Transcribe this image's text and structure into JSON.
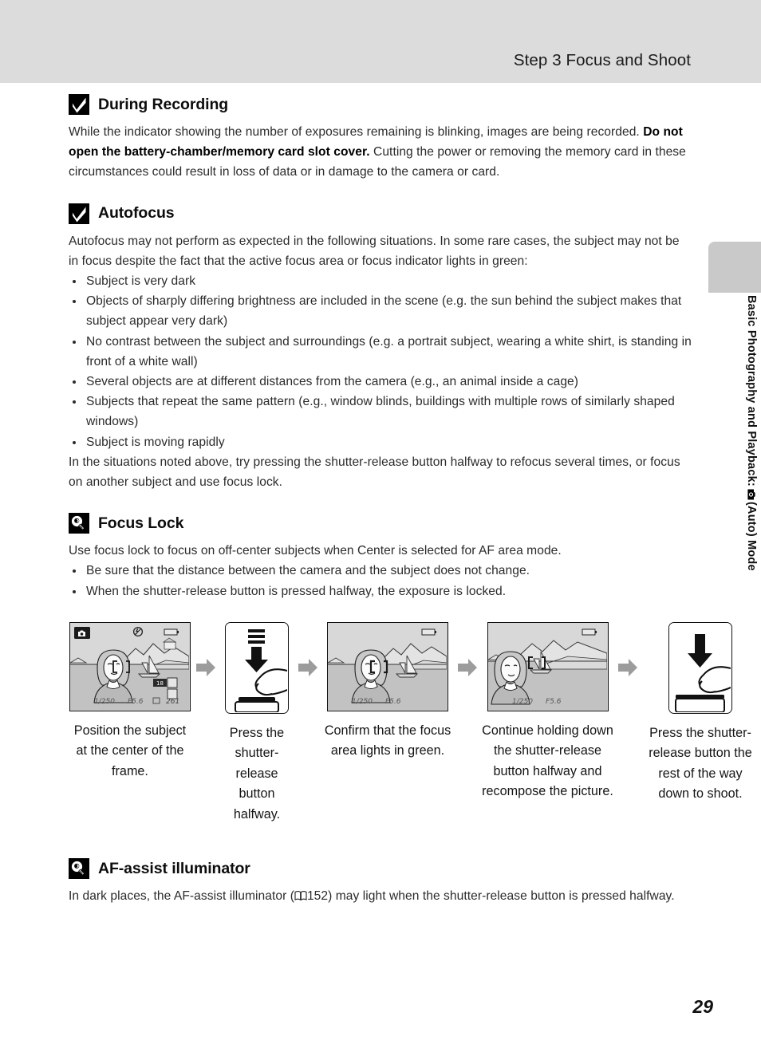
{
  "header": {
    "title": "Step 3 Focus and Shoot",
    "band_color": "#dcdcdc"
  },
  "sidebar": {
    "text_part1": "Basic Photography and Playback:",
    "camera_icon": "camera-auto-icon",
    "text_part2": "(Auto) Mode",
    "tab_color": "#c9c9c9"
  },
  "sections": [
    {
      "id": "during-recording",
      "icon": "checkmark-caution-icon",
      "title": "During Recording",
      "paragraph_pre": "While the indicator showing the number of exposures remaining is blinking, images are being recorded. ",
      "paragraph_bold": "Do not open the battery-chamber/memory card slot cover.",
      "paragraph_post": " Cutting the power or removing the memory card in these circumstances could result in loss of data or in damage to the camera or card."
    },
    {
      "id": "autofocus",
      "icon": "checkmark-caution-icon",
      "title": "Autofocus",
      "intro": "Autofocus may not perform as expected in the following situations. In some rare cases, the subject may not be in focus despite the fact that the active focus area or focus indicator lights in green:",
      "bullets": [
        "Subject is very dark",
        "Objects of sharply differing brightness are included in the scene (e.g. the sun behind the subject makes that subject appear very dark)",
        "No contrast between the subject and surroundings (e.g. a portrait subject, wearing a white shirt, is standing in front of a white wall)",
        "Several objects are at different distances from the camera (e.g., an animal inside a cage)",
        "Subjects that repeat the same pattern (e.g., window blinds, buildings with multiple rows of similarly shaped windows)",
        "Subject is moving rapidly"
      ],
      "outro": "In the situations noted above, try pressing the shutter-release button halfway to refocus several times, or focus on another subject and use focus lock."
    },
    {
      "id": "focus-lock",
      "icon": "lightbulb-tip-icon",
      "title": "Focus Lock",
      "intro": "Use focus lock to focus on off-center subjects when Center is selected for AF area mode.",
      "bullets": [
        "Be sure that the distance between the camera and the subject does not change.",
        "When the shutter-release button is pressed halfway, the exposure is locked."
      ]
    },
    {
      "id": "af-assist",
      "icon": "lightbulb-tip-icon",
      "title": "AF-assist illuminator",
      "text_pre": "In dark places, the AF-assist illuminator (",
      "book_icon": "open-book-reference-icon",
      "page_ref": "152",
      "text_post": ") may light when the shutter-release button is pressed halfway."
    }
  ],
  "flow": {
    "arrow_icon": "right-arrow-icon",
    "steps": [
      {
        "panel_type": "lcd",
        "panel_name": "camera-lcd-framing",
        "osd": {
          "mode_icon": "camera-auto-icon",
          "flash_off_icon": "flash-off-icon",
          "battery_icon": "battery-icon",
          "shutter_speed": "1/250",
          "aperture": "F5.6",
          "image_size": "18",
          "memory_icon": "memory-card-icon",
          "image_mode_icon": "image-quality-icon",
          "frames_icon": "frames-remaining-icon",
          "frames_remaining": "261"
        },
        "caption": "Position the subject at the center of the frame."
      },
      {
        "panel_type": "finger",
        "panel_name": "shutter-press-halfway",
        "press_depth": "halfway",
        "caption": "Press the shutter-release button halfway."
      },
      {
        "panel_type": "lcd",
        "panel_name": "camera-lcd-focus-confirmed",
        "osd": {
          "battery_icon": "battery-icon",
          "shutter_speed": "1/250",
          "aperture": "F5.6"
        },
        "caption": "Confirm that the focus area lights in green."
      },
      {
        "panel_type": "lcd",
        "panel_name": "camera-lcd-recomposed",
        "osd": {
          "battery_icon": "battery-icon",
          "shutter_speed": "1/250",
          "aperture": "F5.6"
        },
        "caption": "Continue holding down the shutter-release button halfway and recompose the picture."
      },
      {
        "panel_type": "finger",
        "panel_name": "shutter-press-full",
        "press_depth": "full",
        "caption": "Press the shutter-release button the rest of the way down to shoot."
      }
    ]
  },
  "footer": {
    "page_number": "29"
  }
}
